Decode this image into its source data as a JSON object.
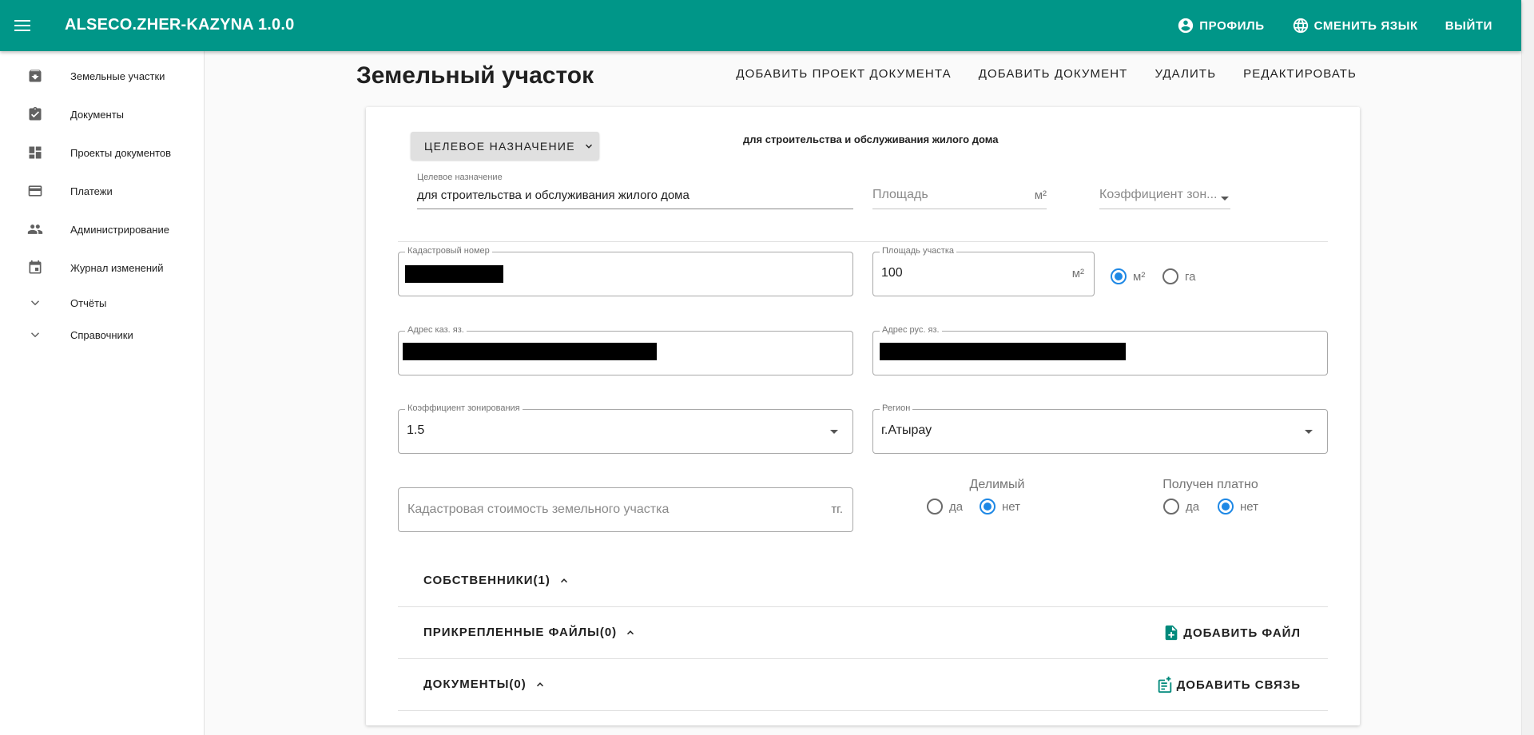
{
  "app": {
    "title": "ALSECO.ZHER-KAZYNA 1.0.0",
    "accent_color": "#009688",
    "header_actions": [
      {
        "label": "ПРОФИЛЬ",
        "icon": "account-circle-icon"
      },
      {
        "label": "СМЕНИТЬ ЯЗЫК",
        "icon": "globe-icon"
      },
      {
        "label": "ВЫЙТИ"
      }
    ]
  },
  "sidebar": {
    "items": [
      {
        "label": "Земельные участки",
        "icon": "archive-icon"
      },
      {
        "label": "Документы",
        "icon": "clipboard-check-icon"
      },
      {
        "label": "Проекты документов",
        "icon": "dashboard-icon"
      },
      {
        "label": "Платежи",
        "icon": "credit-card-icon"
      },
      {
        "label": "Администрирование",
        "icon": "people-icon"
      },
      {
        "label": "Журнал изменений",
        "icon": "calendar-icon"
      },
      {
        "label": "Отчёты",
        "icon": "chevron-down-icon"
      },
      {
        "label": "Справочники",
        "icon": "chevron-down-icon"
      }
    ]
  },
  "page": {
    "title": "Земельный участок",
    "actions": [
      "ДОБАВИТЬ ПРОЕКТ ДОКУМЕНТА",
      "ДОБАВИТЬ ДОКУМЕНТ",
      "УДАЛИТЬ",
      "РЕДАКТИРОВАТЬ"
    ]
  },
  "form": {
    "purpose_button": "ЦЕЛЕВОЕ НАЗНАЧЕНИЕ",
    "purpose_summary": "для строительства и обслуживания жилого дома",
    "purpose_field": {
      "label": "Целевое назначение",
      "value": "для строительства и обслуживания жилого дома"
    },
    "area_field": {
      "placeholder": "Площадь",
      "suffix": "м²"
    },
    "zone_coef_select": {
      "placeholder": "Коэффициент зон..."
    },
    "cadastral_number": {
      "label": "Кадастровый номер",
      "value": ""
    },
    "plot_area": {
      "label": "Площадь участка",
      "value": "100",
      "suffix": "м²"
    },
    "area_units": {
      "options": [
        "м²",
        "га"
      ],
      "selected": "м²"
    },
    "address_kz": {
      "label": "Адрес каз. яз.",
      "value": ""
    },
    "address_ru": {
      "label": "Адрес рус. яз.",
      "value": ""
    },
    "zoning_coefficient": {
      "label": "Коэффициент зонирования",
      "value": "1.5"
    },
    "region": {
      "label": "Регион",
      "value": "г.Атырау"
    },
    "cadastral_cost": {
      "placeholder": "Кадастровая стоимость земельного участка",
      "suffix": "тг."
    },
    "divisible": {
      "label": "Делимый",
      "options": [
        "да",
        "нет"
      ],
      "selected": "нет"
    },
    "paid": {
      "label": "Получен платно",
      "options": [
        "да",
        "нет"
      ],
      "selected": "нет"
    }
  },
  "sections": {
    "owners": {
      "title": "СОБСТВЕННИКИ(1)"
    },
    "files": {
      "title": "ПРИКРЕПЛЕННЫЕ ФАЙЛЫ(0)",
      "action": "ДОБАВИТЬ ФАЙЛ"
    },
    "documents": {
      "title": "ДОКУМЕНТЫ(0)",
      "action": "ДОБАВИТЬ СВЯЗЬ"
    }
  }
}
